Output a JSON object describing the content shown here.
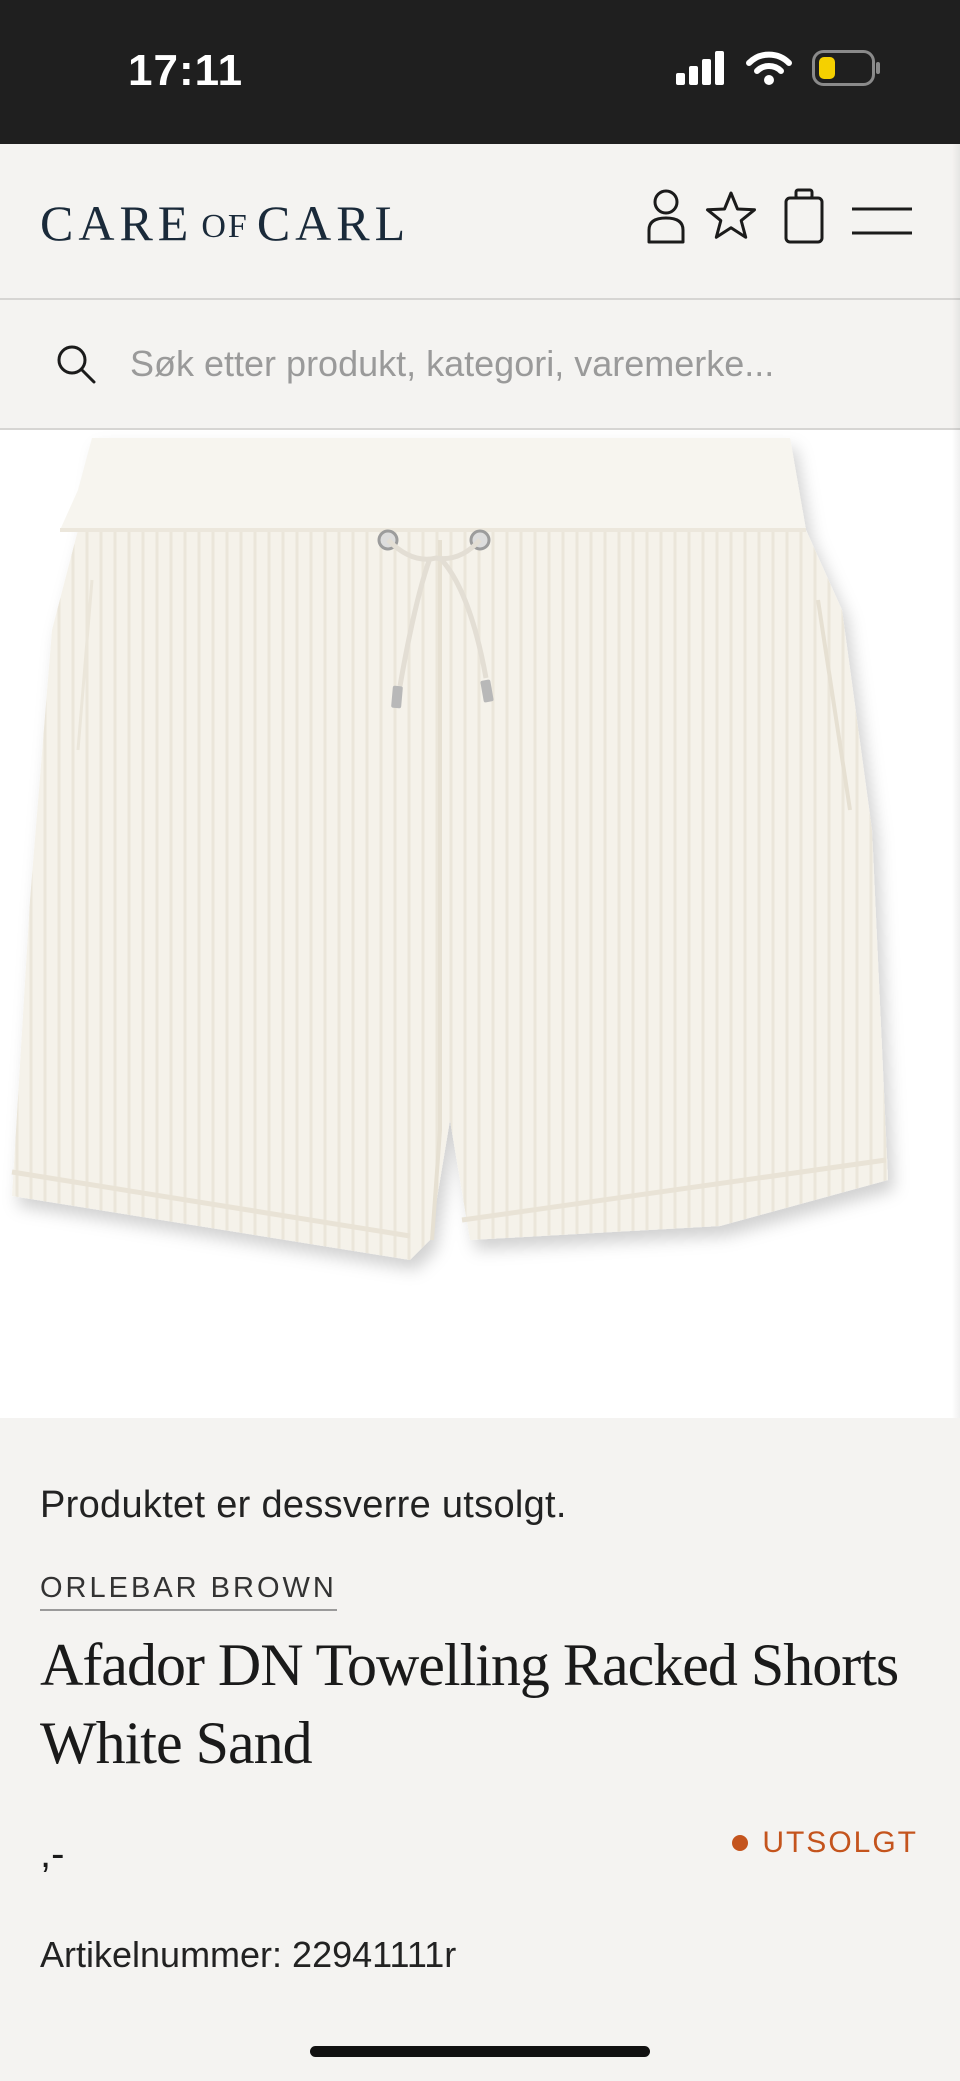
{
  "status_bar": {
    "time": "17:11",
    "icons": [
      "signal-icon",
      "wifi-icon",
      "battery-icon"
    ],
    "battery_color": "#f5d000"
  },
  "header": {
    "logo": {
      "word1": "CARE",
      "word2": "OF",
      "word3": "CARL"
    },
    "icons": [
      "account-icon",
      "wishlist-star-icon",
      "shopping-bag-icon",
      "menu-icon"
    ],
    "brand_color": "#1a2a3a"
  },
  "search": {
    "placeholder": "Søk etter produkt, kategori, varemerke..."
  },
  "product": {
    "image_alt": "white towelling shorts with drawstring",
    "soldout_message": "Produktet er dessverre utsolgt.",
    "brand": "ORLEBAR BROWN",
    "title": "Afador DN Towelling Racked Shorts White Sand",
    "price": ",-",
    "status": "UTSOLGT",
    "status_color": "#c4541d",
    "article_number": "Artikelnummer: 22941111r"
  }
}
